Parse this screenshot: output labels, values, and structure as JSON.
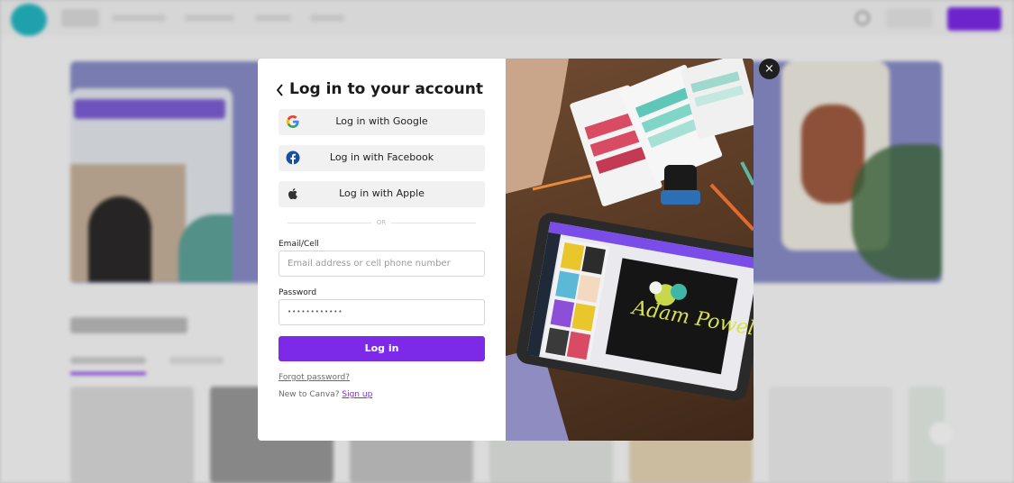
{
  "modal": {
    "back_glyph": "<",
    "title": "Log in to your account",
    "social_buttons": [
      {
        "label": "Log in with Google",
        "icon": "google-icon"
      },
      {
        "label": "Log in with Facebook",
        "icon": "facebook-icon"
      },
      {
        "label": "Log in with Apple",
        "icon": "apple-icon"
      }
    ],
    "divider_text": "OR",
    "email": {
      "label": "Email/Cell",
      "placeholder": "Email address or cell phone number",
      "value": ""
    },
    "password": {
      "label": "Password",
      "value": "••••••••••••"
    },
    "login_label": "Log in",
    "forgot_label": "Forgot password?",
    "new_text": "New to Canva? ",
    "signup_label": "Sign up",
    "close_glyph": "×"
  },
  "image": {
    "signature_text": "Adam Powell"
  },
  "colors": {
    "accent": "#7d2ae8",
    "close_button": "#1f1f1f",
    "social_button_bg": "#f1f1f1"
  }
}
